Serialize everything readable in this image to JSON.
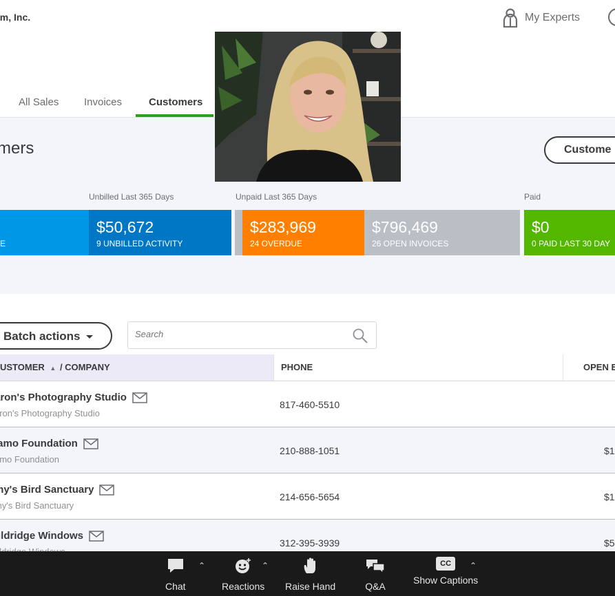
{
  "header": {
    "company": "em, Inc.",
    "my_experts": "My Experts"
  },
  "tabs": [
    {
      "label": "All Sales",
      "active": false
    },
    {
      "label": "Invoices",
      "active": false
    },
    {
      "label": "Customers",
      "active": true
    }
  ],
  "page": {
    "title": "mers",
    "customer_button": "Custome"
  },
  "money_bar": {
    "labels": {
      "unbilled": "Unbilled Last 365 Days",
      "unpaid": "Unpaid Last 365 Days",
      "paid": "Paid"
    },
    "estimate": {
      "sub": "E",
      "color": "#0097e6"
    },
    "unbilled": {
      "amount": "$50,672",
      "sub": "9 UNBILLED ACTIVITY",
      "color": "#0077c5"
    },
    "overdue": {
      "amount": "$283,969",
      "sub": "24 OVERDUE",
      "color": "#ff8000"
    },
    "open_invoices": {
      "amount": "$796,469",
      "sub": "26 OPEN INVOICES",
      "color": "#babec5"
    },
    "paid": {
      "amount": "$0",
      "sub": "0 PAID LAST 30 DAY",
      "color": "#53b700"
    }
  },
  "toolbar": {
    "batch_actions": "Batch actions",
    "search_placeholder": "Search"
  },
  "table": {
    "columns": {
      "customer": "USTOMER",
      "sort_arrow": "▲",
      "company": " / COMPANY",
      "phone": "PHONE",
      "open_balance": "OPEN E"
    },
    "rows": [
      {
        "name": "aron's Photography Studio",
        "company": "aron's Photography Studio",
        "phone": "817-460-5510",
        "open_balance": ""
      },
      {
        "name": "lamo Foundation",
        "company": "amo Foundation",
        "phone": "210-888-1051",
        "open_balance": "$1"
      },
      {
        "name": "my's Bird Sanctuary",
        "company": "my's Bird Sanctuary",
        "phone": "214-656-5654",
        "open_balance": "$1"
      },
      {
        "name": "uldridge Windows",
        "company": "uldridge Windows",
        "phone": "312-395-3939",
        "open_balance": "$5"
      }
    ]
  },
  "zoom": {
    "chat": "Chat",
    "reactions": "Reactions",
    "raise_hand": "Raise Hand",
    "qa": "Q&A",
    "captions": "Show Captions",
    "cc": "CC"
  }
}
